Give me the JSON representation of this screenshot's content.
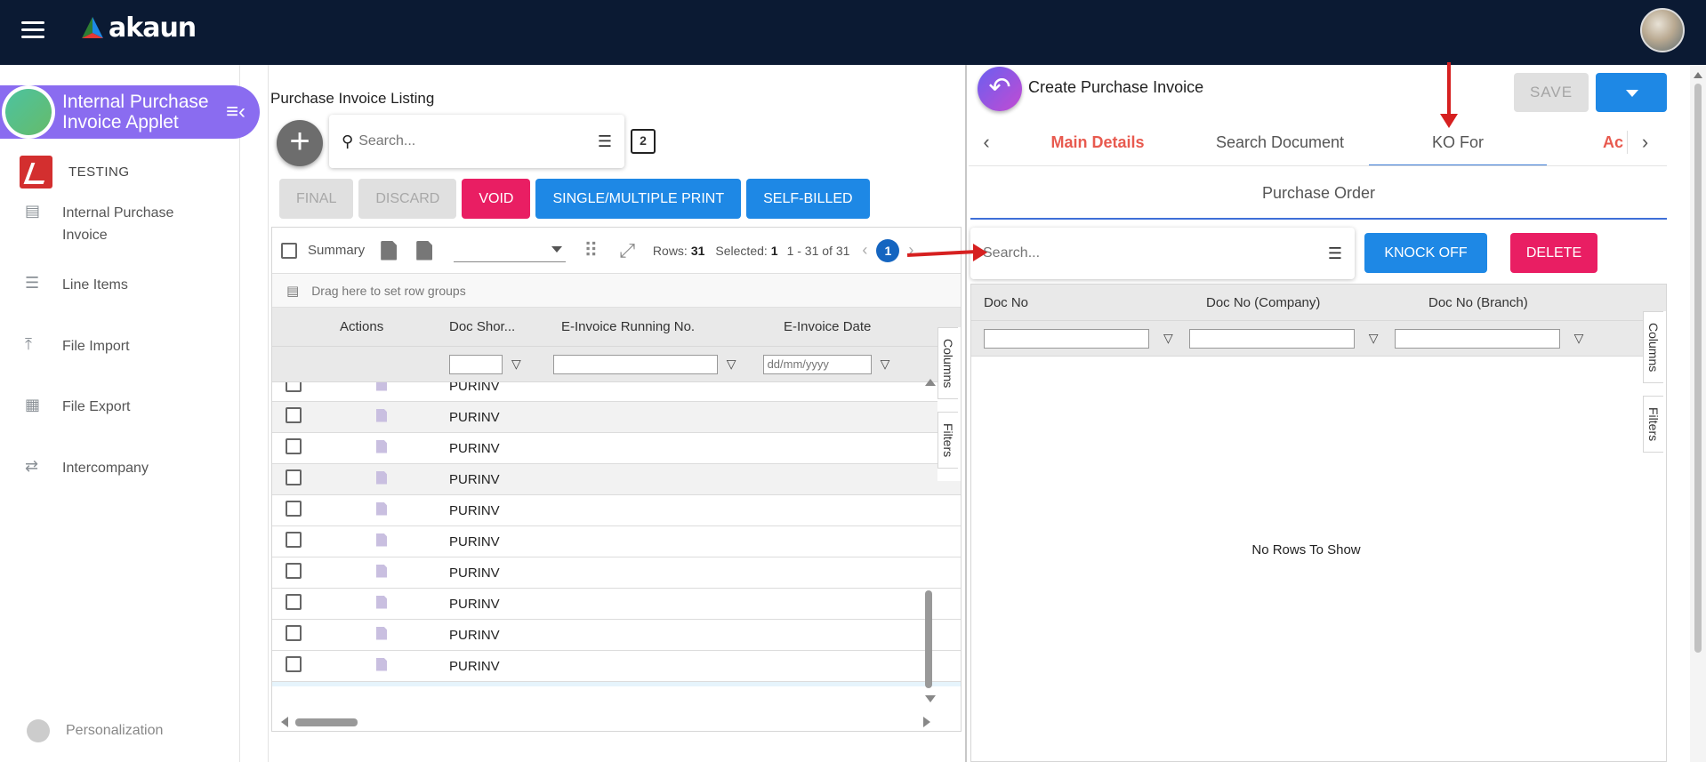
{
  "app": {
    "logo_text": "akaun",
    "brand_color": "#0b1a33"
  },
  "sidebar": {
    "applet_title": "Internal Purchase Invoice Applet",
    "company": "TESTING",
    "items": [
      {
        "label": "Internal Purchase Invoice",
        "icon": "invoice-icon"
      },
      {
        "label": "Line Items",
        "icon": "list-icon"
      },
      {
        "label": "File Import",
        "icon": "upload-icon"
      },
      {
        "label": "File Export",
        "icon": "export-icon"
      },
      {
        "label": "Intercompany",
        "icon": "transfer-icon"
      }
    ],
    "personalization": "Personalization"
  },
  "listing": {
    "title": "Purchase Invoice Listing",
    "search_placeholder": "Search...",
    "buttons": {
      "final": "FINAL",
      "discard": "DISCARD",
      "void": "VOID",
      "print": "SINGLE/MULTIPLE PRINT",
      "self_billed": "SELF-BILLED"
    },
    "toolbar": {
      "summary": "Summary",
      "rows_label": "Rows:",
      "rows_value": "31",
      "selected_label": "Selected:",
      "selected_value": "1",
      "range": "1 - 31 of 31",
      "page": "1"
    },
    "row_groups_hint": "Drag here to set row groups",
    "columns": [
      "Actions",
      "Doc Shor...",
      "E-Invoice Running No.",
      "E-Invoice Date"
    ],
    "date_placeholder": "dd/mm/yyyy",
    "rows": [
      "PURINV",
      "PURINV",
      "PURINV",
      "PURINV",
      "PURINV",
      "PURINV",
      "PURINV",
      "PURINV",
      "PURINV",
      "PURINV"
    ],
    "side_tabs": {
      "columns": "Columns",
      "filters": "Filters"
    }
  },
  "create": {
    "title": "Create Purchase Invoice",
    "save": "SAVE",
    "tabs": [
      "Main Details",
      "Search Document",
      "KO For",
      "Ac"
    ],
    "active_tab": "KO For",
    "subtab": "Purchase Order",
    "search_placeholder": "Search...",
    "knock_off": "KNOCK OFF",
    "delete": "DELETE",
    "columns": [
      "Doc No",
      "Doc No (Company)",
      "Doc No (Branch)"
    ],
    "no_rows": "No Rows To Show",
    "side_tabs": {
      "columns": "Columns",
      "filters": "Filters"
    }
  },
  "colors": {
    "accent_blue": "#1e88e5",
    "pink": "#e91e63",
    "applet_purple": "#8a6cf0",
    "annotation_red": "#d62020"
  }
}
